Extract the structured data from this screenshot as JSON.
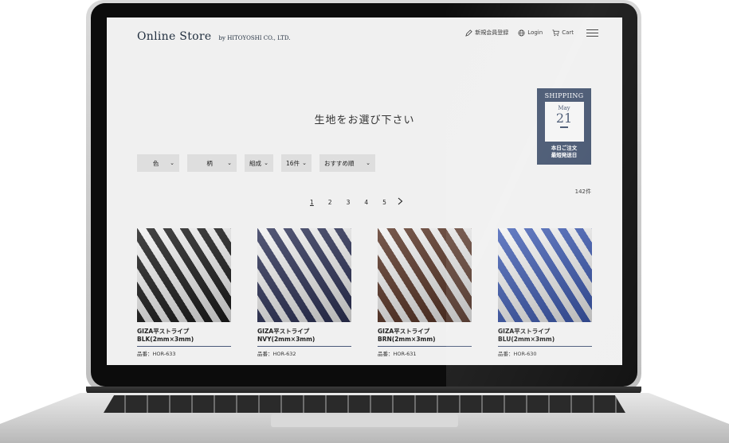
{
  "header": {
    "brand": "Online Store",
    "brand_sub": "by HITOYOSHI CO., LTD.",
    "nav": {
      "register": "新規会員登録",
      "login": "Login",
      "cart": "Cart"
    }
  },
  "shipping": {
    "title": "SHIPPIING",
    "month": "May",
    "day": "21",
    "note_line1": "本日ご注文",
    "note_line2": "最短発送日"
  },
  "page_title": "生地をお選び下さい",
  "filters": [
    {
      "label": "色"
    },
    {
      "label": "柄"
    },
    {
      "label": "組成"
    },
    {
      "label": "16件"
    },
    {
      "label": "おすすめ順"
    }
  ],
  "result_count": "142件",
  "pagination": {
    "pages": [
      "1",
      "2",
      "3",
      "4",
      "5"
    ],
    "current": "1",
    "next_icon": "chevron-right-icon"
  },
  "products": [
    {
      "name_line1": "GIZA平ストライプ",
      "name_line2": "BLK(2mm×3mm)",
      "code": "品番：HOR-633",
      "color": "#1c1c1c"
    },
    {
      "name_line1": "GIZA平ストライプ",
      "name_line2": "NVY(2mm×3mm)",
      "code": "品番：HOR-632",
      "color": "#2e3358"
    },
    {
      "name_line1": "GIZA平ストライプ",
      "name_line2": "BRN(2mm×3mm)",
      "code": "品番：HOR-631",
      "color": "#5a3526"
    },
    {
      "name_line1": "GIZA平ストライプ",
      "name_line2": "BLU(2mm×3mm)",
      "code": "品番：HOR-630",
      "color": "#2f4fae"
    }
  ],
  "colors": {
    "accent_navy": "#3f4f6b",
    "screen_bg": "#f0f0f0"
  }
}
